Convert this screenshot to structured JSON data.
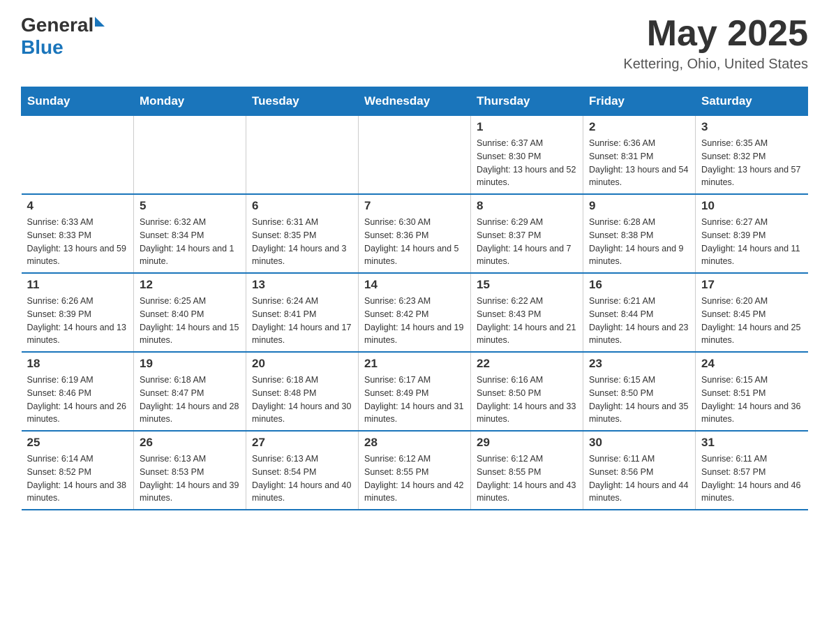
{
  "logo": {
    "general": "General",
    "blue": "Blue"
  },
  "title": "May 2025",
  "location": "Kettering, Ohio, United States",
  "days_of_week": [
    "Sunday",
    "Monday",
    "Tuesday",
    "Wednesday",
    "Thursday",
    "Friday",
    "Saturday"
  ],
  "weeks": [
    [
      {
        "day": "",
        "info": ""
      },
      {
        "day": "",
        "info": ""
      },
      {
        "day": "",
        "info": ""
      },
      {
        "day": "",
        "info": ""
      },
      {
        "day": "1",
        "info": "Sunrise: 6:37 AM\nSunset: 8:30 PM\nDaylight: 13 hours and 52 minutes."
      },
      {
        "day": "2",
        "info": "Sunrise: 6:36 AM\nSunset: 8:31 PM\nDaylight: 13 hours and 54 minutes."
      },
      {
        "day": "3",
        "info": "Sunrise: 6:35 AM\nSunset: 8:32 PM\nDaylight: 13 hours and 57 minutes."
      }
    ],
    [
      {
        "day": "4",
        "info": "Sunrise: 6:33 AM\nSunset: 8:33 PM\nDaylight: 13 hours and 59 minutes."
      },
      {
        "day": "5",
        "info": "Sunrise: 6:32 AM\nSunset: 8:34 PM\nDaylight: 14 hours and 1 minute."
      },
      {
        "day": "6",
        "info": "Sunrise: 6:31 AM\nSunset: 8:35 PM\nDaylight: 14 hours and 3 minutes."
      },
      {
        "day": "7",
        "info": "Sunrise: 6:30 AM\nSunset: 8:36 PM\nDaylight: 14 hours and 5 minutes."
      },
      {
        "day": "8",
        "info": "Sunrise: 6:29 AM\nSunset: 8:37 PM\nDaylight: 14 hours and 7 minutes."
      },
      {
        "day": "9",
        "info": "Sunrise: 6:28 AM\nSunset: 8:38 PM\nDaylight: 14 hours and 9 minutes."
      },
      {
        "day": "10",
        "info": "Sunrise: 6:27 AM\nSunset: 8:39 PM\nDaylight: 14 hours and 11 minutes."
      }
    ],
    [
      {
        "day": "11",
        "info": "Sunrise: 6:26 AM\nSunset: 8:39 PM\nDaylight: 14 hours and 13 minutes."
      },
      {
        "day": "12",
        "info": "Sunrise: 6:25 AM\nSunset: 8:40 PM\nDaylight: 14 hours and 15 minutes."
      },
      {
        "day": "13",
        "info": "Sunrise: 6:24 AM\nSunset: 8:41 PM\nDaylight: 14 hours and 17 minutes."
      },
      {
        "day": "14",
        "info": "Sunrise: 6:23 AM\nSunset: 8:42 PM\nDaylight: 14 hours and 19 minutes."
      },
      {
        "day": "15",
        "info": "Sunrise: 6:22 AM\nSunset: 8:43 PM\nDaylight: 14 hours and 21 minutes."
      },
      {
        "day": "16",
        "info": "Sunrise: 6:21 AM\nSunset: 8:44 PM\nDaylight: 14 hours and 23 minutes."
      },
      {
        "day": "17",
        "info": "Sunrise: 6:20 AM\nSunset: 8:45 PM\nDaylight: 14 hours and 25 minutes."
      }
    ],
    [
      {
        "day": "18",
        "info": "Sunrise: 6:19 AM\nSunset: 8:46 PM\nDaylight: 14 hours and 26 minutes."
      },
      {
        "day": "19",
        "info": "Sunrise: 6:18 AM\nSunset: 8:47 PM\nDaylight: 14 hours and 28 minutes."
      },
      {
        "day": "20",
        "info": "Sunrise: 6:18 AM\nSunset: 8:48 PM\nDaylight: 14 hours and 30 minutes."
      },
      {
        "day": "21",
        "info": "Sunrise: 6:17 AM\nSunset: 8:49 PM\nDaylight: 14 hours and 31 minutes."
      },
      {
        "day": "22",
        "info": "Sunrise: 6:16 AM\nSunset: 8:50 PM\nDaylight: 14 hours and 33 minutes."
      },
      {
        "day": "23",
        "info": "Sunrise: 6:15 AM\nSunset: 8:50 PM\nDaylight: 14 hours and 35 minutes."
      },
      {
        "day": "24",
        "info": "Sunrise: 6:15 AM\nSunset: 8:51 PM\nDaylight: 14 hours and 36 minutes."
      }
    ],
    [
      {
        "day": "25",
        "info": "Sunrise: 6:14 AM\nSunset: 8:52 PM\nDaylight: 14 hours and 38 minutes."
      },
      {
        "day": "26",
        "info": "Sunrise: 6:13 AM\nSunset: 8:53 PM\nDaylight: 14 hours and 39 minutes."
      },
      {
        "day": "27",
        "info": "Sunrise: 6:13 AM\nSunset: 8:54 PM\nDaylight: 14 hours and 40 minutes."
      },
      {
        "day": "28",
        "info": "Sunrise: 6:12 AM\nSunset: 8:55 PM\nDaylight: 14 hours and 42 minutes."
      },
      {
        "day": "29",
        "info": "Sunrise: 6:12 AM\nSunset: 8:55 PM\nDaylight: 14 hours and 43 minutes."
      },
      {
        "day": "30",
        "info": "Sunrise: 6:11 AM\nSunset: 8:56 PM\nDaylight: 14 hours and 44 minutes."
      },
      {
        "day": "31",
        "info": "Sunrise: 6:11 AM\nSunset: 8:57 PM\nDaylight: 14 hours and 46 minutes."
      }
    ]
  ]
}
